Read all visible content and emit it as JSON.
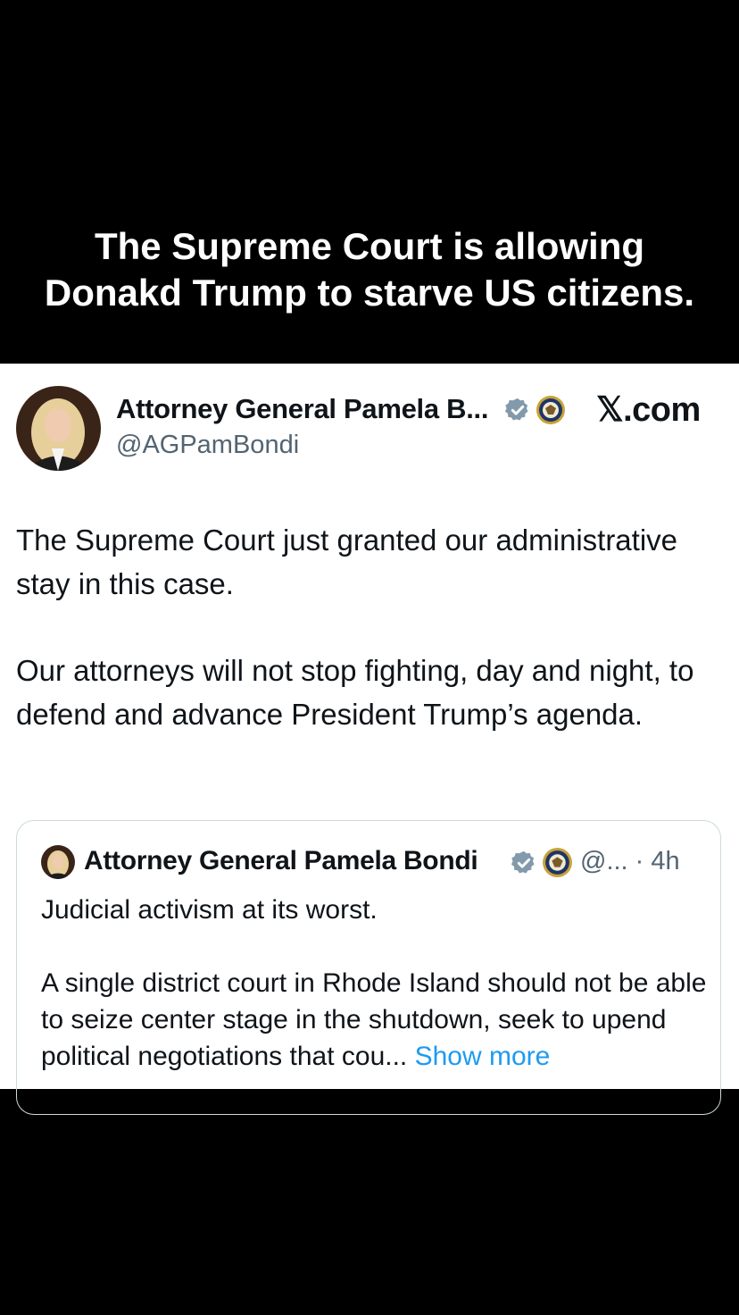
{
  "caption": {
    "line1": "The Supreme Court is allowing",
    "line2": "Donakd Trump to starve US citizens."
  },
  "post": {
    "author_name": "Attorney General Pamela B...",
    "handle": "@AGPamBondi",
    "platform": "𝕏.com",
    "paragraphs": [
      "The Supreme Court just granted our administrative stay in this case.",
      "Our attorneys will not stop fighting, day and night, to defend and advance President Trump’s agenda."
    ],
    "icons": {
      "verified": "verified-badge-icon",
      "seal": "doj-seal-icon"
    }
  },
  "quoted_post": {
    "author_name": "Attorney General Pamela Bondi",
    "meta": "@... · 4h",
    "paragraph1": "Judicial activism at its worst.",
    "paragraph2": "A single district court in Rhode Island should not be able to seize center stage in the shutdown, seek to upend political negotiations that cou...",
    "show_more": "Show more"
  },
  "colors": {
    "background": "#000000",
    "card": "#ffffff",
    "text_primary": "#0f1419",
    "text_secondary": "#536471",
    "verified_badge": "#829aab",
    "link": "#1d9bf0"
  }
}
